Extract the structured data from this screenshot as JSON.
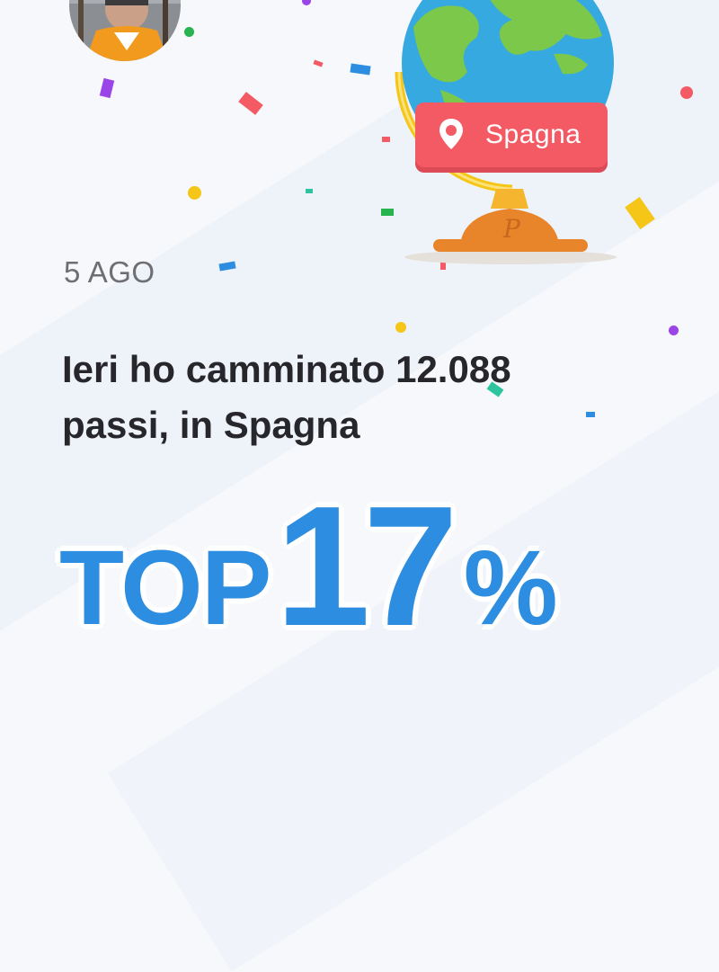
{
  "share_card": {
    "location": "Spagna",
    "date": "5 AGO",
    "headline_line1": "Ieri ho camminato 12.088",
    "headline_line2": "passi, in Spagna",
    "rank_prefix": "TOP",
    "rank_value": "17",
    "rank_suffix": "%"
  },
  "icons": {
    "avatar": "user-avatar",
    "globe": "globe-trophy-icon",
    "pin": "map-pin-icon",
    "logo": "pacer-p-logo"
  },
  "colors": {
    "accent": "#2d8de0",
    "badge": "#f35a63",
    "text_dark": "#27272b",
    "text_muted": "#6e6e73",
    "globe_ocean": "#36a9e1",
    "globe_land": "#7cc84a",
    "stand": "#f5b52e",
    "base": "#e8852a"
  }
}
